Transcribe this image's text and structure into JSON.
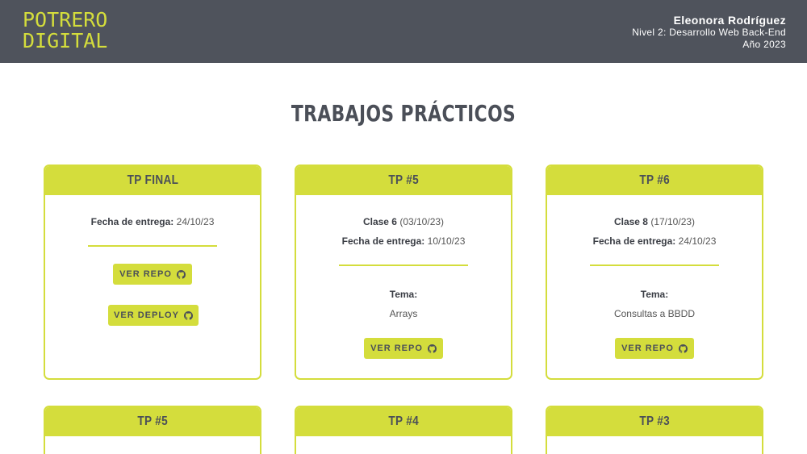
{
  "header": {
    "logo_line1": "POTRERO",
    "logo_line2": "DIGITAL",
    "student_name": "Eleonora Rodríguez",
    "level": "Nivel 2: Desarrollo Web Back-End",
    "year": "Año 2023"
  },
  "page": {
    "title": "TRABAJOS PRÁCTICOS"
  },
  "colors": {
    "accent": "#d4dd3c",
    "header_bg": "#4f535c",
    "text": "#4b4f58"
  },
  "icons": {
    "repo": "github-icon",
    "deploy": "github-icon"
  },
  "cards": [
    {
      "title": "TP FINAL",
      "fecha_label": "Fecha de entrega:",
      "fecha": "24/10/23",
      "btn_repo": "VER REPO",
      "btn_deploy": "VER DEPLOY"
    },
    {
      "title": "TP #5",
      "clase_label": "Clase 6",
      "clase_date": "(03/10/23)",
      "fecha_label": "Fecha de entrega:",
      "fecha": "10/10/23",
      "tema_label": "Tema:",
      "tema": "Arrays",
      "btn_repo": "VER REPO"
    },
    {
      "title": "TP #6",
      "clase_label": "Clase 8",
      "clase_date": "(17/10/23)",
      "fecha_label": "Fecha de entrega:",
      "fecha": "24/10/23",
      "tema_label": "Tema:",
      "tema": "Consultas a BBDD",
      "btn_repo": "VER REPO"
    },
    {
      "title": "TP #5"
    },
    {
      "title": "TP #4"
    },
    {
      "title": "TP #3"
    }
  ]
}
